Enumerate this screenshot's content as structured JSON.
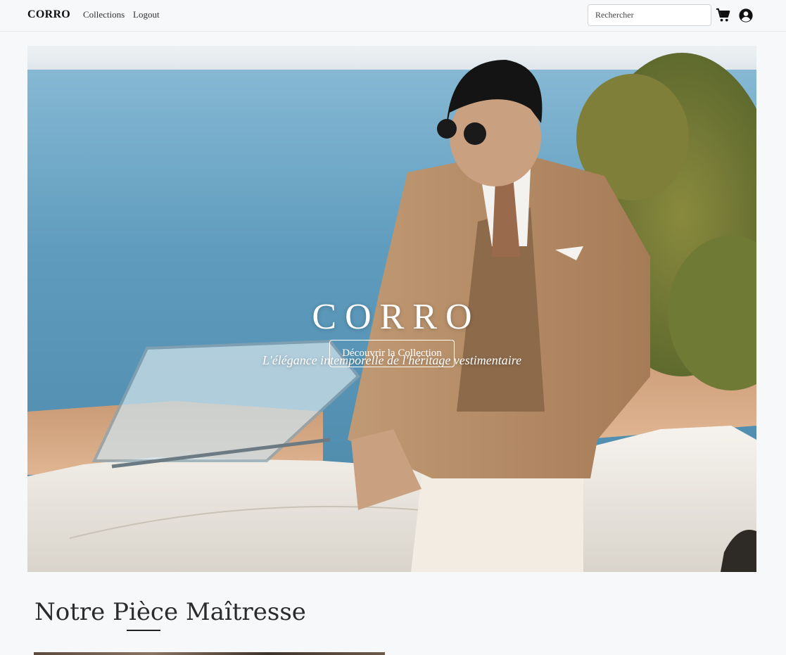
{
  "navbar": {
    "brand": "CORRO",
    "links": [
      {
        "label": "Collections"
      },
      {
        "label": "Logout"
      }
    ],
    "search": {
      "placeholder": "Rechercher",
      "value": ""
    },
    "icons": [
      "cart-icon",
      "user-circle-icon"
    ]
  },
  "hero": {
    "title": "CORRO",
    "subtitle": "L'élégance intemporelle de l'héritage vestimentaire",
    "cta_label": "Découvrir la Collection"
  },
  "featured": {
    "title": "Notre Pièce Maîtresse"
  },
  "colors": {
    "background": "#f7f8fa",
    "text": "#222222",
    "sea": "#4f8fb4",
    "jacket": "#b38b66",
    "car": "#ece9e2"
  }
}
